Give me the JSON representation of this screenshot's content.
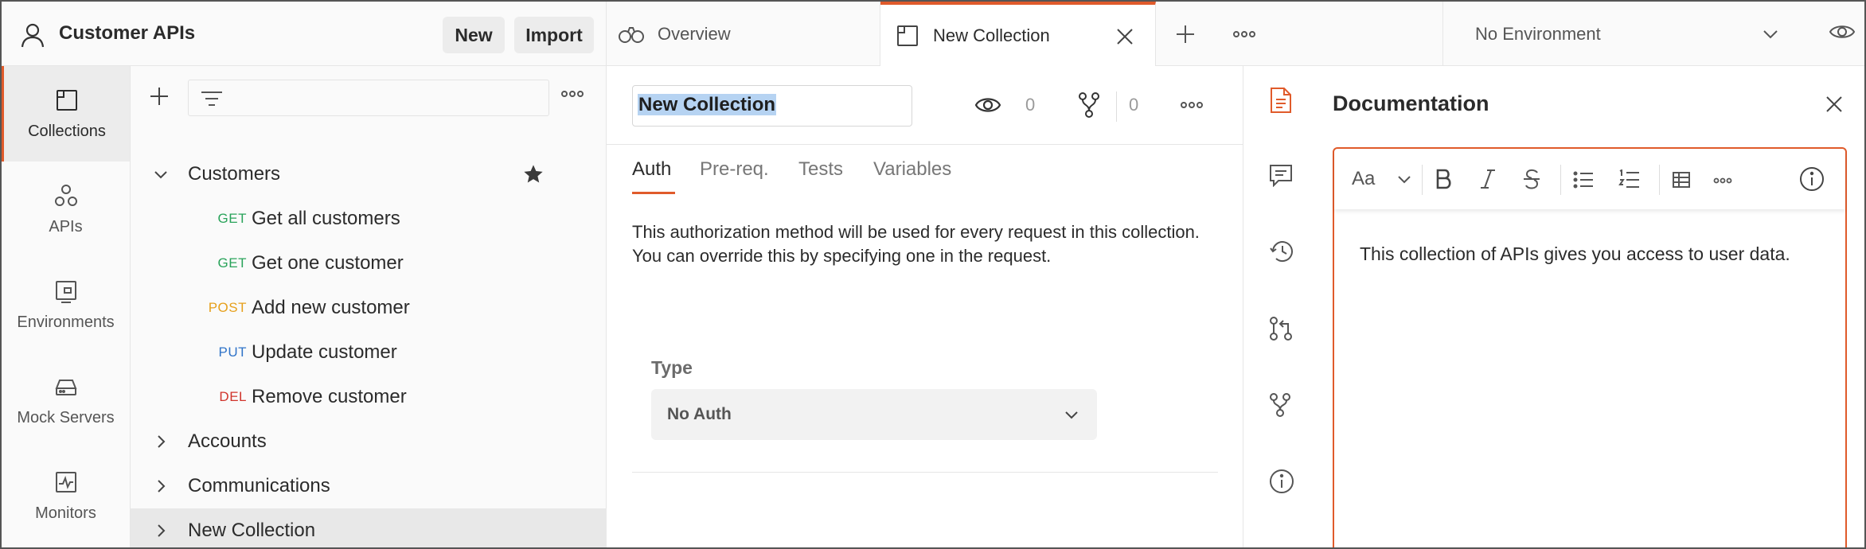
{
  "workspace": {
    "title": "Customer APIs",
    "new_label": "New",
    "import_label": "Import"
  },
  "leftnav": {
    "items": [
      {
        "label": "Collections",
        "icon": "collections-icon",
        "active": true
      },
      {
        "label": "APIs",
        "icon": "apis-icon"
      },
      {
        "label": "Environments",
        "icon": "environments-icon"
      },
      {
        "label": "Mock Servers",
        "icon": "mock-servers-icon"
      },
      {
        "label": "Monitors",
        "icon": "monitors-icon"
      }
    ]
  },
  "sidebar": {
    "search_placeholder": "",
    "tree": {
      "customers": {
        "label": "Customers"
      },
      "requests": [
        {
          "method": "GET",
          "label": "Get all customers"
        },
        {
          "method": "GET",
          "label": "Get one customer"
        },
        {
          "method": "POST",
          "label": "Add new customer"
        },
        {
          "method": "PUT",
          "label": "Update customer"
        },
        {
          "method": "DEL",
          "label": "Remove customer"
        }
      ],
      "accounts": {
        "label": "Accounts"
      },
      "communications": {
        "label": "Communications"
      },
      "new_collection": {
        "label": "New Collection"
      }
    }
  },
  "tabs": {
    "overview": "Overview",
    "new_collection": "New Collection",
    "environment": "No Environment"
  },
  "main": {
    "collection_name": "New Collection",
    "watch_count": "0",
    "fork_count": "0",
    "sub_tabs": {
      "auth": "Auth",
      "prereq": "Pre-req.",
      "tests": "Tests",
      "variables": "Variables"
    },
    "auth_description": "This authorization method will be used for every request in this collection. You can override this by specifying one in the request.",
    "type_label": "Type",
    "type_value": "No Auth"
  },
  "docs": {
    "title": "Documentation",
    "font_button": "Aa",
    "body": "This collection of APIs gives you access to user data."
  },
  "colors": {
    "accent": "#e05b2b",
    "get": "#29a35a",
    "post": "#e6a01c",
    "put": "#2f73c8",
    "delete": "#d0342c"
  }
}
